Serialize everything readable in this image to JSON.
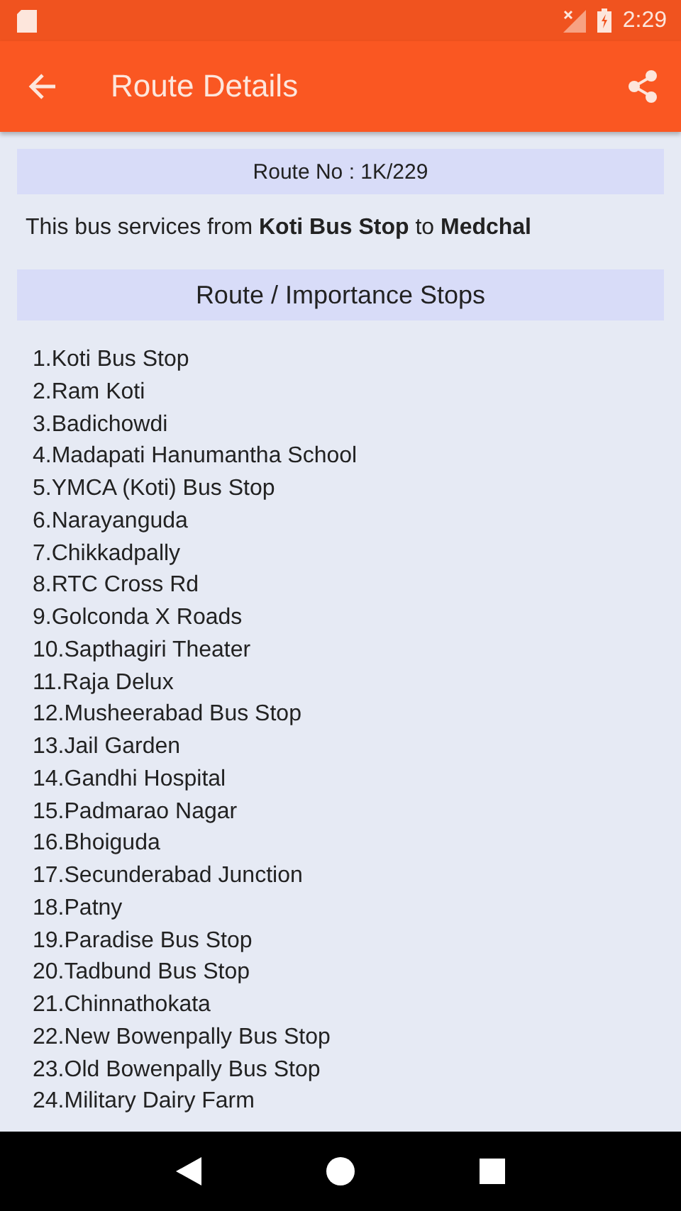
{
  "status_bar": {
    "time": "2:29"
  },
  "app_bar": {
    "title": "Route Details"
  },
  "route_number": "Route No : 1K/229",
  "description": "This bus services from **Koti Bus Stop** to **Medchal**",
  "stops_header": "Route / Importance Stops",
  "stops": [
    "1.Koti Bus Stop",
    "2.Ram Koti",
    "3.Badichowdi",
    "4.Madapati Hanumantha School",
    "5.YMCA (Koti) Bus Stop",
    "6.Narayanguda",
    "7.Chikkadpally",
    "8.RTC Cross Rd",
    "9.Golconda X Roads",
    "10.Sapthagiri Theater",
    "11.Raja Delux",
    "12.Musheerabad Bus Stop",
    "13.Jail Garden",
    "14.Gandhi Hospital",
    "15.Padmarao Nagar",
    "16.Bhoiguda",
    "17.Secunderabad Junction",
    "18.Patny",
    "19.Paradise Bus Stop",
    "20.Tadbund Bus Stop",
    "21.Chinnathokata",
    "22.New Bowenpally Bus Stop",
    "23.Old Bowenpally Bus Stop",
    "24.Military Dairy Farm"
  ]
}
